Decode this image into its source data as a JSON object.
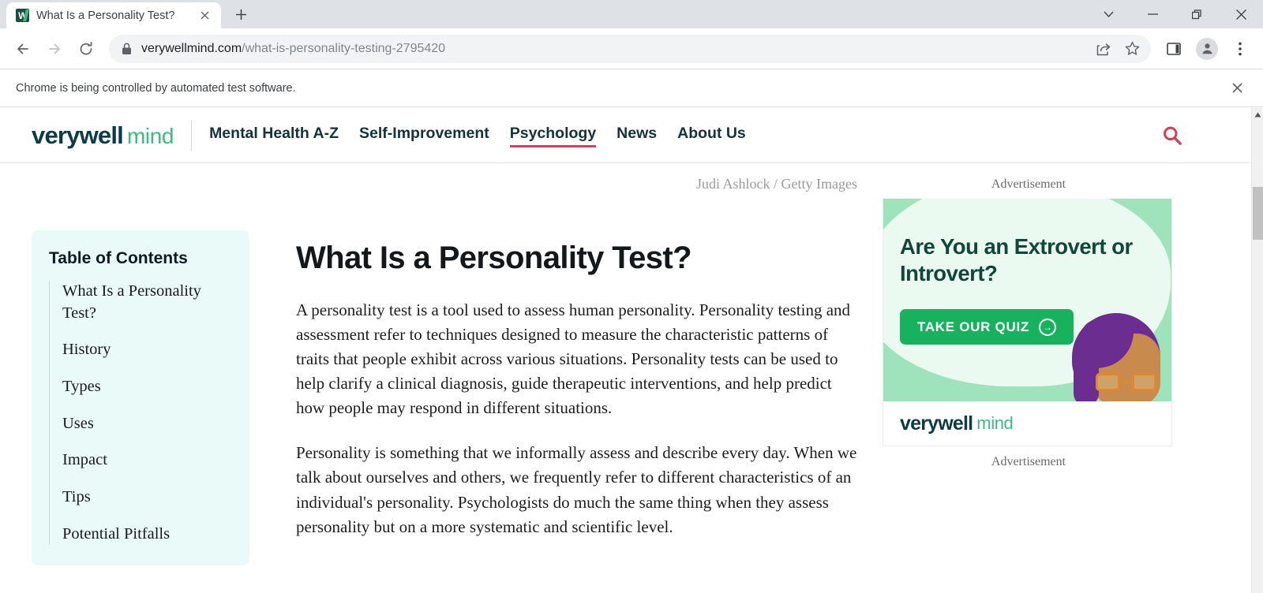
{
  "browser": {
    "tab": {
      "title": "What Is a Personality Test?",
      "favicon_letter": "W",
      "favicon_name": "verywell-favicon",
      "close_label": "×"
    },
    "new_tab_label": "+",
    "window_controls": {
      "tab_search": "tab-search-chevron",
      "minimize": "minimize",
      "maximize": "restore",
      "close": "close"
    },
    "toolbar": {
      "back": "back-arrow",
      "forward": "forward-arrow",
      "reload": "reload",
      "lock": "lock-icon",
      "url_domain": "verywellmind.com",
      "url_path": "/what-is-personality-testing-2795420",
      "share": "share-icon",
      "bookmark": "star-icon",
      "side_panel": "side-panel-icon",
      "profile": "profile-avatar",
      "menu": "three-dot-menu"
    },
    "infobar": {
      "message": "Chrome is being controlled by automated test software.",
      "close_label": "✕"
    }
  },
  "site": {
    "logo": {
      "primary": "verywell",
      "secondary": "mind"
    },
    "nav": [
      {
        "label": "Mental Health A-Z",
        "active": false
      },
      {
        "label": "Self-Improvement",
        "active": false
      },
      {
        "label": "Psychology",
        "active": true
      },
      {
        "label": "News",
        "active": false
      },
      {
        "label": "About Us",
        "active": false
      }
    ],
    "search_icon": "search-icon"
  },
  "toc": {
    "title": "Table of Contents",
    "items": [
      "What Is a Personality Test?",
      "History",
      "Types",
      "Uses",
      "Impact",
      "Tips",
      "Potential Pitfalls"
    ]
  },
  "article": {
    "image_credit": "Judi Ashlock / Getty Images",
    "title": "What Is a Personality Test?",
    "paragraphs": [
      "A personality test is a tool used to assess human personality. Personality testing and assessment refer to techniques designed to measure the characteristic patterns of traits that people exhibit across various situations. Personality tests can be used to help clarify a clinical diagnosis, guide therapeutic interventions, and help predict how people may respond in different situations.",
      "Personality is something that we informally assess and describe every day. When we talk about ourselves and others, we frequently refer to different characteristics of an individual's personality. Psychologists do much the same thing when they assess personality but on a more systematic and scientific level."
    ]
  },
  "ads": {
    "label_top": "Advertisement",
    "label_bottom": "Advertisement",
    "creative": {
      "headline": "Are You an Extrovert or Introvert?",
      "cta_label": "TAKE OUR QUIZ",
      "cta_arrow": "→",
      "brand_primary": "verywell",
      "brand_secondary": "mind"
    }
  },
  "colors": {
    "brand_dark": "#0d3b45",
    "brand_green": "#3fb984",
    "accent_red": "#d1425a",
    "toc_bg": "#eafaf8",
    "ad_green": "#9fe3bd",
    "cta_green": "#18b25e"
  }
}
